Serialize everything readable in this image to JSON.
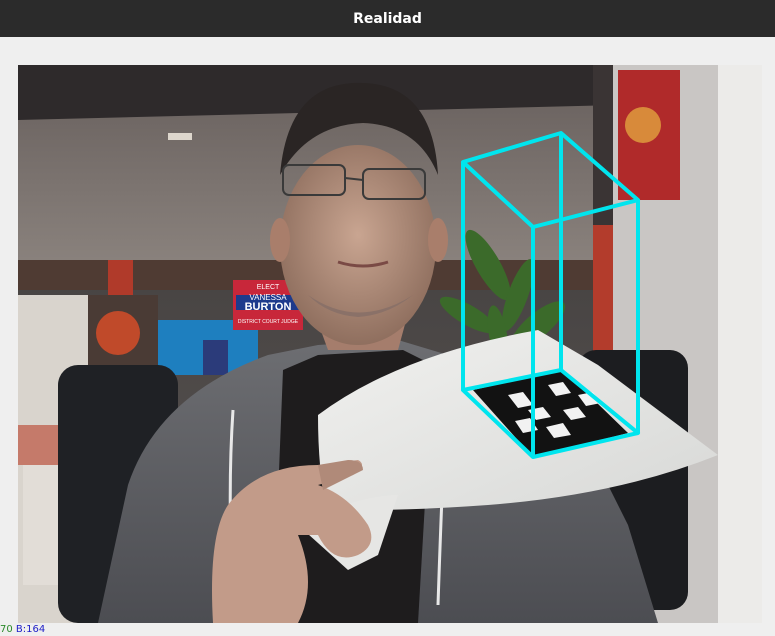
{
  "window": {
    "title": "Realidad"
  },
  "camera": {
    "poster": {
      "line1": "ELECT",
      "line2": "VANESSA",
      "line3": "BURTON",
      "line4": "DISTRICT COURT JUDGE"
    },
    "overlay_color": "#00e5ee"
  },
  "status": {
    "g_text": "70",
    "b_text": "B:164"
  }
}
